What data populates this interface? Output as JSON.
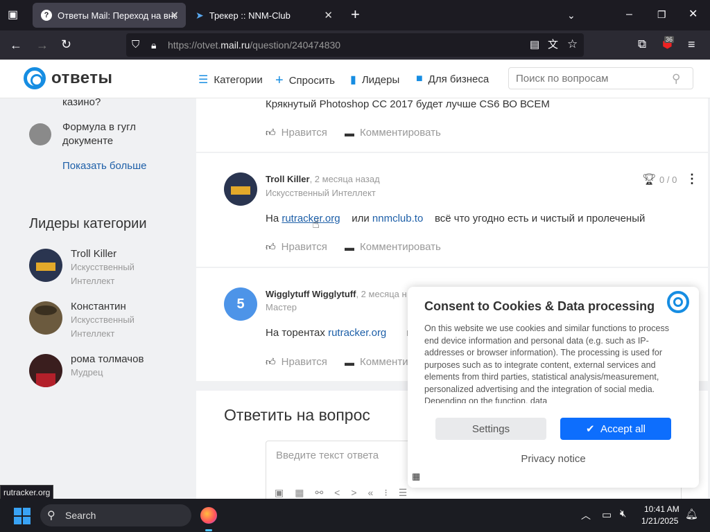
{
  "browser": {
    "tabs": [
      {
        "title": "Ответы Mail: Переход на внеш",
        "active": true
      },
      {
        "title": "Трекер :: NNM-Club",
        "active": false
      }
    ],
    "url_prefix": "https://otvet.",
    "url_domain": "mail.ru",
    "url_path": "/question/240474830",
    "badge_count": "36",
    "status_url": "rutracker.org"
  },
  "site": {
    "logo": "ответы",
    "nav": [
      {
        "label": "Категории",
        "icon": "list-icon"
      },
      {
        "label": "Спросить",
        "icon": "plus-icon"
      },
      {
        "label": "Лидеры",
        "icon": "bar-chart-icon"
      },
      {
        "label": "Для бизнеса",
        "icon": "briefcase-icon"
      }
    ],
    "search_placeholder": "Поиск по вопросам"
  },
  "sidebar": {
    "related": [
      {
        "text": "казино?"
      },
      {
        "text": "Формула в гугл документе"
      }
    ],
    "show_more": "Показать больше",
    "leaders_title": "Лидеры категории",
    "leaders": [
      {
        "name": "Troll Killer",
        "rank": "Искусственный Интеллект"
      },
      {
        "name": "Константин",
        "rank": "Искусственный Интеллект"
      },
      {
        "name": "рома толмачов",
        "rank": "Мудрец"
      }
    ]
  },
  "answers": [
    {
      "text": "Крякнутый Photoshop CC 2017 будет лучше CS6 ВО ВСЕМ",
      "like": "Нравится",
      "comment": "Комментировать"
    },
    {
      "author": "Troll Killer",
      "time": ", 2 месяца назад",
      "rank": "Искусственный Интеллект",
      "score": "0 / 0",
      "text_pre": "На ",
      "link1": "rutracker.org",
      "text_mid": " или ",
      "link2": "nnmclub.to",
      "text_post": "всё что угодно есть и чистый и пролеченый",
      "like": "Нравится",
      "comment": "Комментировать"
    },
    {
      "author": "Wigglytuff Wigglytuff",
      "time": ", 2 месяца н",
      "rank": "Мастер",
      "avatar_letter": "5",
      "text_pre": "На торентах ",
      "link1": "rutracker.org",
      "text_post": "и",
      "like": "Нравится",
      "comment": "Комменти"
    }
  ],
  "reply": {
    "title": "Ответить на вопрос",
    "placeholder": "Введите текст ответа"
  },
  "consent": {
    "title": "Consent to Cookies & Data processing",
    "body": "On this website we use cookies and similar functions to process end device information and personal data (e.g. such as IP-addresses or browser information). The processing is used for purposes such as to integrate content, external services and elements from third parties, statistical analysis/measurement, personalized advertising and the integration of social media. Depending on the function, data",
    "settings": "Settings",
    "accept": "Accept all",
    "privacy": "Privacy notice"
  },
  "taskbar": {
    "search": "Search",
    "time": "10:41 AM",
    "date": "1/21/2025"
  },
  "colors": {
    "accent": "#168de2",
    "link": "#1d5fa8",
    "button": "#0d6efd",
    "browser_bg": "#1c1b22"
  }
}
